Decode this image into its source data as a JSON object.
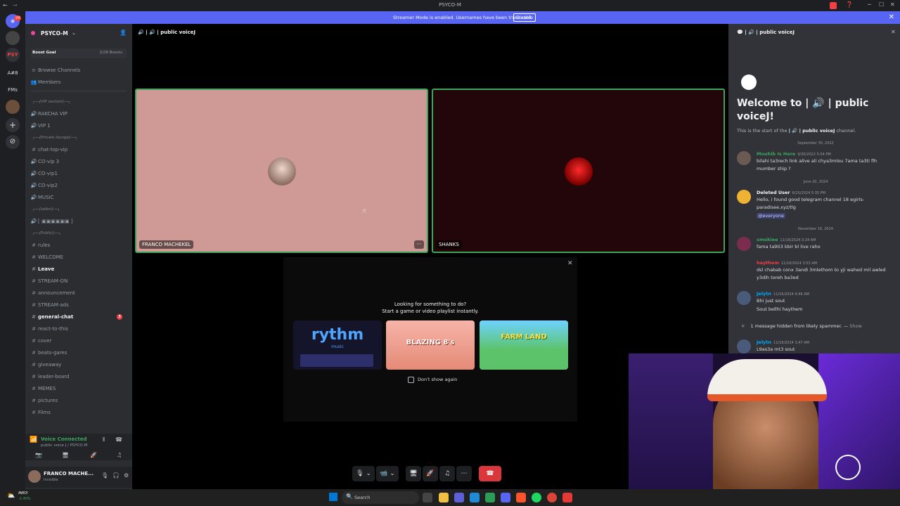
{
  "window": {
    "title": "PSYCO-M"
  },
  "banner": {
    "text": "Streamer Mode is enabled. Usernames have been truncated.",
    "disable_label": "Disable"
  },
  "servers": [
    "PSY",
    "A#8",
    "FMs"
  ],
  "server_sidebar": {
    "notification_badge": "24"
  },
  "guild": {
    "name": "PSYCO-M",
    "boost_goal": "Boost Goal",
    "boost_count": "2/28 Boosts"
  },
  "nav": {
    "browse": "Browse Channels",
    "members": "Members"
  },
  "channels": [
    {
      "label": "┌──[VIP section]──┐",
      "kind": "cat"
    },
    {
      "label": "RAKCHA VIP",
      "kind": "voice"
    },
    {
      "label": "VIP 1",
      "kind": "voice"
    },
    {
      "label": "┌──[Private lounge]──┐",
      "kind": "cat"
    },
    {
      "label": "chat-top-vip",
      "kind": "text"
    },
    {
      "label": "CO-vip 3",
      "kind": "voice"
    },
    {
      "label": "CO-vip1",
      "kind": "voice"
    },
    {
      "label": "CO-vip2",
      "kind": "voice"
    },
    {
      "label": "MUSIC",
      "kind": "voice"
    },
    {
      "label": "┌──[safon]──┐",
      "kind": "cat"
    },
    {
      "label": "[ ▣▣▣▣▣▣ ]",
      "kind": "voice"
    },
    {
      "label": "┌──[Public]──┐",
      "kind": "cat"
    },
    {
      "label": "rules",
      "kind": "text"
    },
    {
      "label": "WELCOME",
      "kind": "text"
    },
    {
      "label": "Leave",
      "kind": "text-bold"
    },
    {
      "label": "STREAM-ON",
      "kind": "text"
    },
    {
      "label": "announcement",
      "kind": "text"
    },
    {
      "label": "STREAM-ads",
      "kind": "text"
    },
    {
      "label": "general-chat",
      "kind": "text-bold",
      "badge": "3"
    },
    {
      "label": "react-to-this",
      "kind": "text"
    },
    {
      "label": "cover",
      "kind": "text"
    },
    {
      "label": "beats-gares",
      "kind": "text"
    },
    {
      "label": "giveaway",
      "kind": "text"
    },
    {
      "label": "leader-board",
      "kind": "text"
    },
    {
      "label": "MEMES",
      "kind": "text"
    },
    {
      "label": "pictures",
      "kind": "text"
    },
    {
      "label": "Films",
      "kind": "text"
    }
  ],
  "voice": {
    "status": "Voice Connected",
    "channel": "public voice J / PSYCO-M"
  },
  "user": {
    "name": "FRANCO MACHE...",
    "status": "Invisible"
  },
  "call": {
    "channel_name": "public voiceJ",
    "tiles": [
      {
        "name": "FRANCO MACHEKEL",
        "bg": "#cf9995"
      },
      {
        "name": "SHANKS",
        "bg": "#230609"
      }
    ]
  },
  "activity": {
    "heading": "Looking for something to do?",
    "subheading": "Start a game or video playlist instantly.",
    "games": [
      "rythm",
      "BLAZING 8's",
      "FARM LAND"
    ],
    "game_sub": "music",
    "dont_show": "Don't show again"
  },
  "chat": {
    "header": "public voiceJ",
    "welcome_prefix": "Welcome to",
    "welcome_channel": "| 🔊 | public voiceJ!",
    "start_text_pre": "This is the start of the",
    "start_text_channel": "| 🔊 | public voiceJ",
    "start_text_post": "channel.",
    "dates": [
      "September 30, 2022",
      "June 20, 2024",
      "November 16, 2024"
    ],
    "messages": [
      {
        "author": "Mouhib Is Here",
        "time": "9/30/2022 5:54 PM",
        "text": "bilahi ta3rech link alive  ali chya3mlou 7ama ta3ti fih mumber ship ?",
        "color": "#3ba55c"
      },
      {
        "author": "Deleted User",
        "time": "6/20/2024 5:35 PM",
        "text": "Hello, i found good telegram channel 18 egirls-paradisee.xyz/tlg",
        "mention": "@everyone",
        "color": "#f2f3f5"
      },
      {
        "author": "smokiee",
        "time": "11/16/2024 3:24 AM",
        "text": "fama ta9ti3 kbir bl live raho",
        "color": "#3ba55c"
      },
      {
        "author": "haythem",
        "time": "11/16/2024 3:53 AM",
        "text": "dsl chabab conx 3andi 3mlethom to yji wahed mil awled y3dih toreh ba3ed",
        "color": "#f23f43"
      },
      {
        "author": "Jelytn",
        "time": "11/16/2024 6:46 AM",
        "text": "Bhi just sout",
        "text2": "Sout bellhi haythem",
        "color": "#00a8fc"
      },
      {
        "author": "Jelytn",
        "time": "11/16/2024 3:47 AM",
        "text": "L9as3a mt3 sout",
        "color": "#00a8fc"
      }
    ],
    "hidden_text": "1 message hidden from likely spammer. —",
    "hidden_show": "Show"
  },
  "taskbar": {
    "search": "Search",
    "weather_temp": "AWO!",
    "weather_change": "-1.40%"
  }
}
